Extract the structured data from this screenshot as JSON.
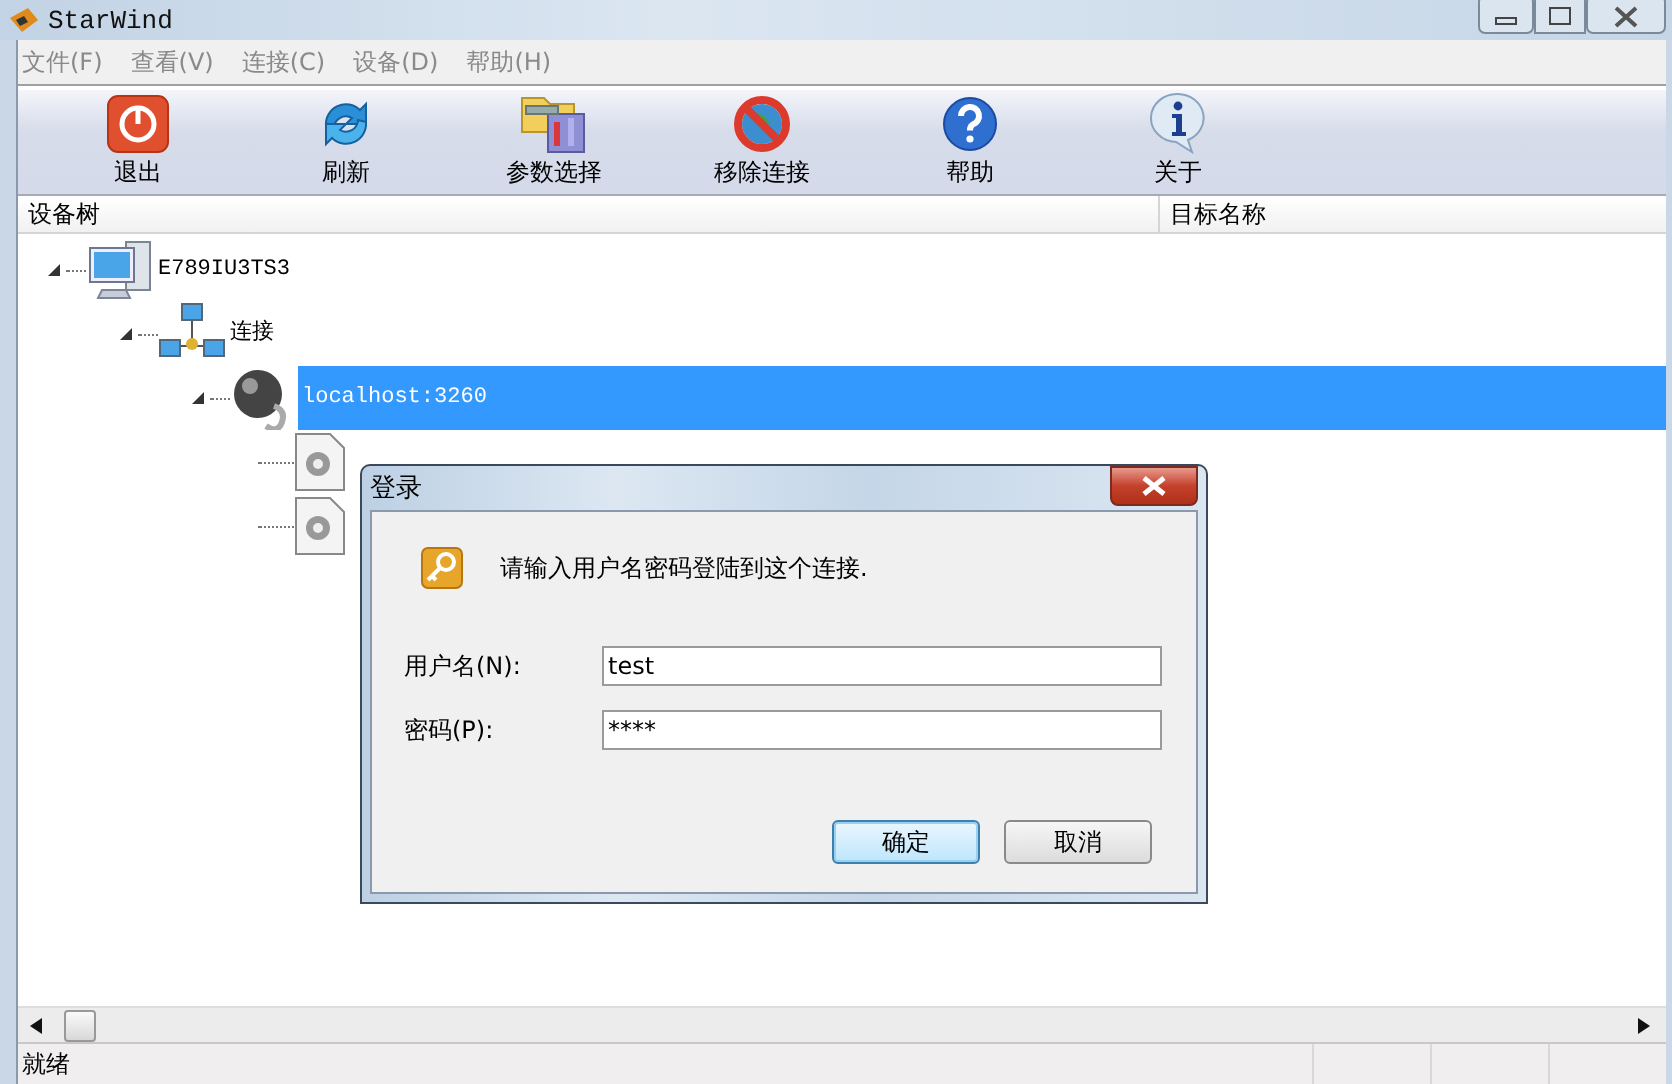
{
  "window": {
    "title": "StarWind"
  },
  "menu": [
    {
      "label": "文件(F)"
    },
    {
      "label": "查看(V)"
    },
    {
      "label": "连接(C)"
    },
    {
      "label": "设备(D)"
    },
    {
      "label": "帮助(H)"
    }
  ],
  "toolbar": [
    {
      "label": "退出",
      "kind": "exit"
    },
    {
      "label": "刷新",
      "kind": "refresh"
    },
    {
      "label": "参数选择",
      "kind": "settings"
    },
    {
      "label": "移除连接",
      "kind": "remove"
    },
    {
      "label": "帮助",
      "kind": "help"
    },
    {
      "label": "关于",
      "kind": "about"
    }
  ],
  "columns": [
    "设备树",
    "目标名称"
  ],
  "tree": [
    {
      "label": "E789IU3TS3",
      "kind": "computer",
      "expanded": true,
      "selected": false,
      "children": [
        {
          "label": "连接",
          "kind": "network",
          "expanded": true,
          "selected": false,
          "children": [
            {
              "label": "localhost:3260",
              "kind": "server",
              "expanded": true,
              "selected": true,
              "children": [
                {
                  "kind": "device"
                },
                {
                  "kind": "device"
                }
              ]
            }
          ]
        }
      ]
    }
  ],
  "status_bar": {
    "text": "就绪"
  },
  "dialog": {
    "title": "登录",
    "message": "请输入用户名密码登陆到这个连接.",
    "fields": [
      {
        "label": "用户名(N):",
        "value": "test"
      },
      {
        "label": "密码(P):",
        "value": "****"
      }
    ],
    "buttons": [
      {
        "label": "确定",
        "default": true
      },
      {
        "label": "取消",
        "default": false
      }
    ]
  }
}
